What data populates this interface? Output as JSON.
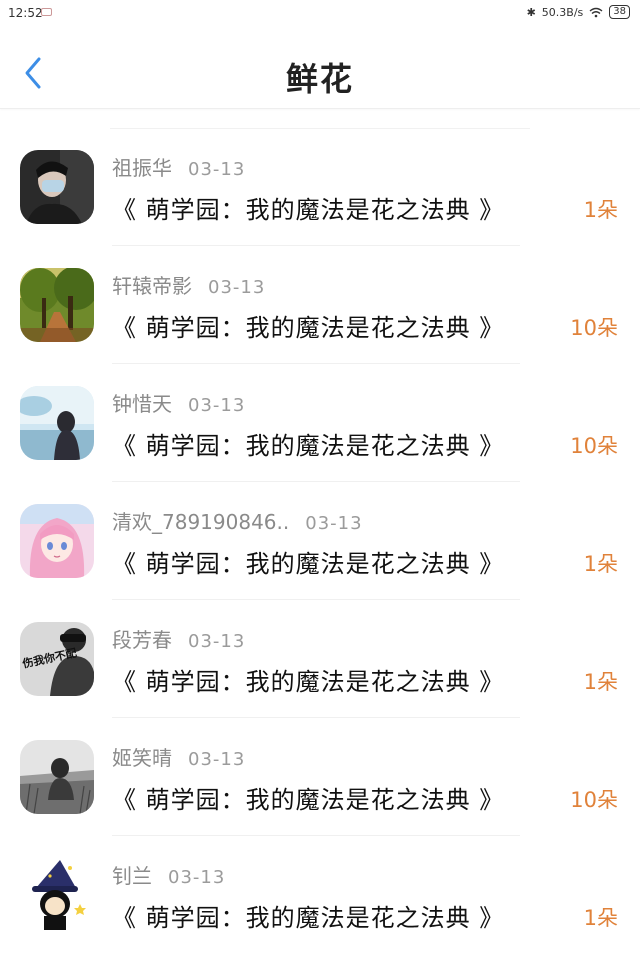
{
  "status_bar": {
    "time": "12:52",
    "network_speed": "50.3B/s",
    "battery": "38"
  },
  "header": {
    "title": "鲜花"
  },
  "records": [
    {
      "name": "祖振华",
      "date": "03-13",
      "book": "《 萌学园：我的魔法是花之法典 》",
      "amount": "1朵",
      "avatar": "avatar-dark-portrait"
    },
    {
      "name": "轩辕帝影",
      "date": "03-13",
      "book": "《 萌学园：我的魔法是花之法典 》",
      "amount": "10朵",
      "avatar": "avatar-forest"
    },
    {
      "name": "钟惜天",
      "date": "03-13",
      "book": "《 萌学园：我的魔法是花之法典 》",
      "amount": "10朵",
      "avatar": "avatar-girl-sky"
    },
    {
      "name": "清欢_789190846..",
      "date": "03-13",
      "book": "《 萌学园：我的魔法是花之法典 》",
      "amount": "1朵",
      "avatar": "avatar-anime-girl"
    },
    {
      "name": "段芳春",
      "date": "03-13",
      "book": "《 萌学园：我的魔法是花之法典 》",
      "amount": "1朵",
      "avatar": "avatar-bw-text",
      "avatar_text": "伤我你不配"
    },
    {
      "name": "姬笑晴",
      "date": "03-13",
      "book": "《 萌学园：我的魔法是花之法典 》",
      "amount": "10朵",
      "avatar": "avatar-bw-field"
    },
    {
      "name": "钊兰",
      "date": "03-13",
      "book": "《 萌学园：我的魔法是花之法典 》",
      "amount": "1朵",
      "avatar": "avatar-witch-cartoon"
    }
  ],
  "colors": {
    "accent_back": "#3d8ee6",
    "amount": "#e0823a"
  }
}
